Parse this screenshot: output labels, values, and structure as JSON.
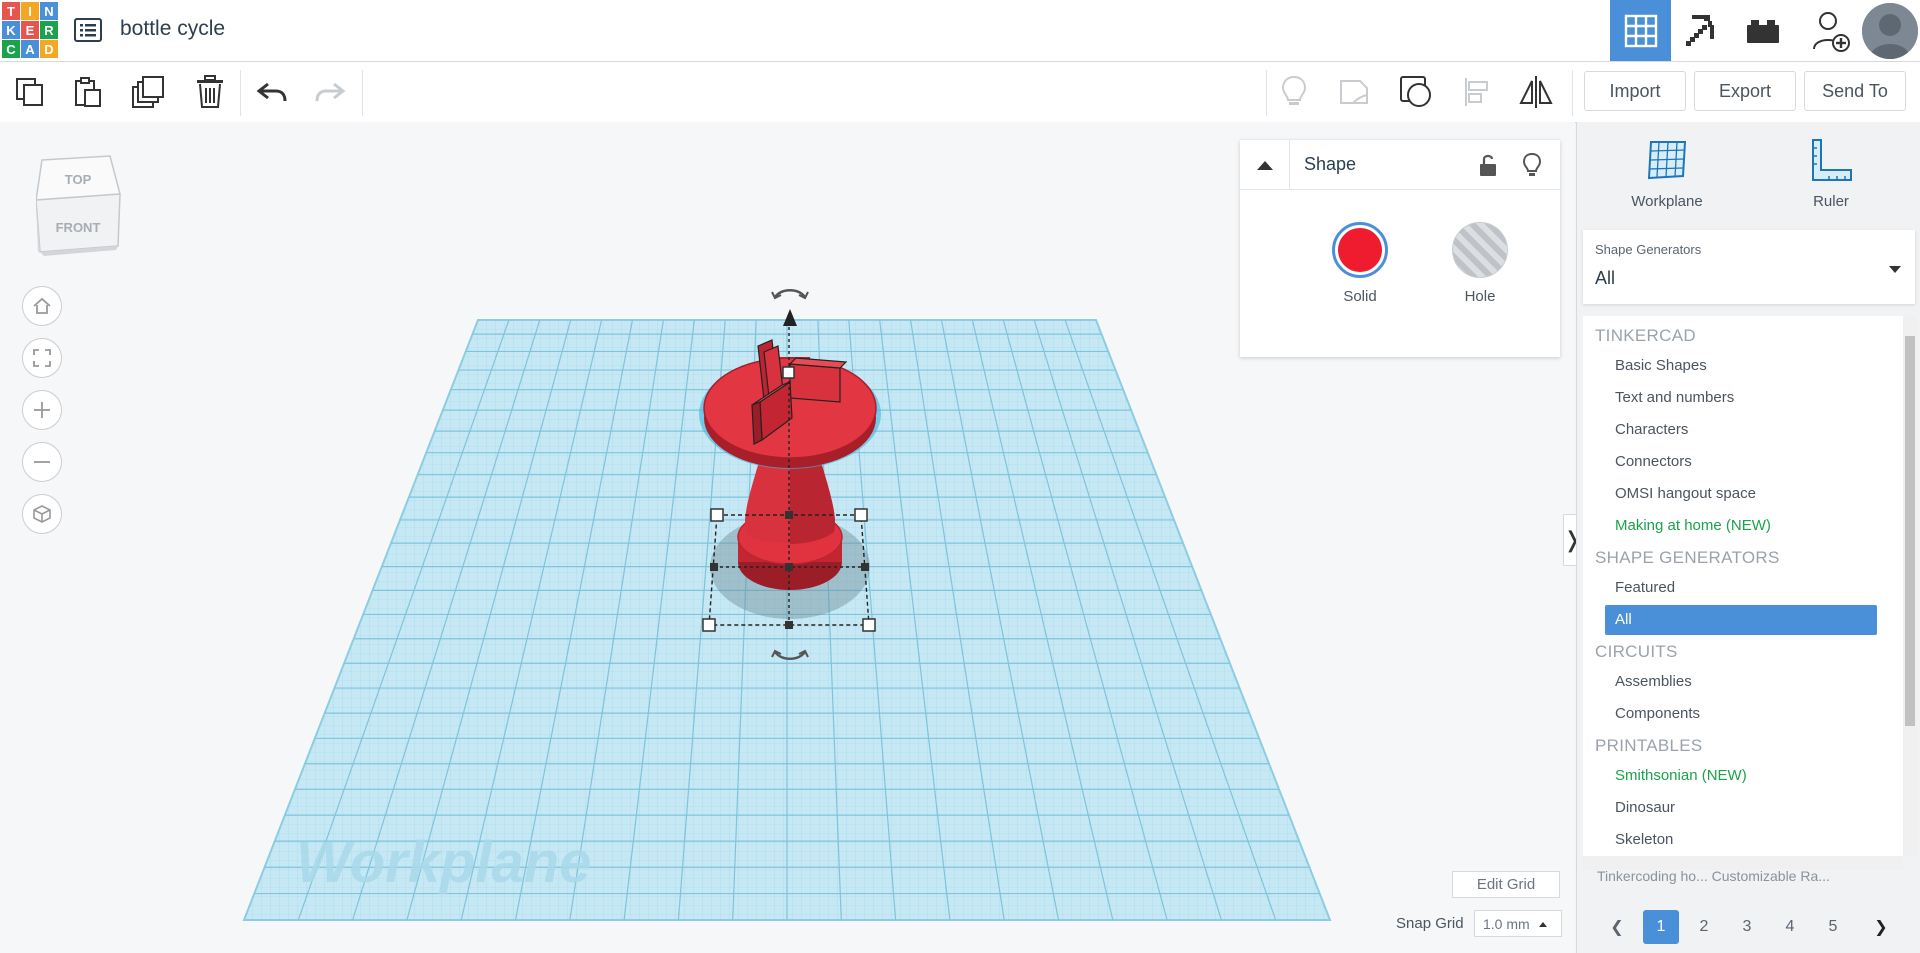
{
  "app": {
    "logo_letters": [
      "T",
      "I",
      "N",
      "K",
      "E",
      "R",
      "C",
      "A",
      "D"
    ],
    "logo_colors": [
      "#e8554e",
      "#f5a623",
      "#4a90d9",
      "#4a90d9",
      "#e8554e",
      "#1aa34a",
      "#1aa34a",
      "#4a90d9",
      "#f5a623"
    ],
    "design_title": "bottle cycle",
    "accent_color": "#4a90d9"
  },
  "header": {
    "buttons": [
      {
        "name": "3d-design-view",
        "icon": "grid-icon",
        "active": true
      },
      {
        "name": "codeblocks",
        "icon": "pickaxe-icon",
        "active": false
      },
      {
        "name": "bricks-view",
        "icon": "brick-icon",
        "active": false
      },
      {
        "name": "add-user",
        "icon": "add-user-icon",
        "active": false
      }
    ]
  },
  "toolbar": {
    "left_icons": [
      "copy-icon",
      "paste-icon",
      "duplicate-icon",
      "delete-icon",
      "undo-icon",
      "redo-icon"
    ],
    "right_icons": [
      "light-bulb-icon",
      "note-icon",
      "show-all-icon",
      "align-icon",
      "mirror-icon"
    ],
    "import_label": "Import",
    "export_label": "Export",
    "send_to_label": "Send To"
  },
  "viewcube": {
    "top_label": "TOP",
    "front_label": "FRONT"
  },
  "viewport": {
    "workplane_watermark": "Workplane",
    "edit_grid_label": "Edit Grid",
    "snap_grid_label": "Snap Grid",
    "snap_grid_value": "1.0 mm"
  },
  "inspector": {
    "title": "Shape",
    "solid_label": "Solid",
    "hole_label": "Hole",
    "solid_color": "#ee1c2e"
  },
  "right_panel": {
    "workplane_label": "Workplane",
    "ruler_label": "Ruler",
    "generators_label": "Shape Generators",
    "generators_value": "All",
    "library": [
      {
        "type": "cat",
        "label": "TINKERCAD"
      },
      {
        "type": "item",
        "label": "Basic Shapes"
      },
      {
        "type": "item",
        "label": "Text and numbers"
      },
      {
        "type": "item",
        "label": "Characters"
      },
      {
        "type": "item",
        "label": "Connectors"
      },
      {
        "type": "item",
        "label": "OMSI hangout space"
      },
      {
        "type": "item",
        "label": "Making at home (NEW)",
        "green": true
      },
      {
        "type": "cat",
        "label": "SHAPE GENERATORS"
      },
      {
        "type": "item",
        "label": "Featured"
      },
      {
        "type": "item",
        "label": "All",
        "selected": true
      },
      {
        "type": "cat",
        "label": "CIRCUITS"
      },
      {
        "type": "item",
        "label": "Assemblies"
      },
      {
        "type": "item",
        "label": "Components"
      },
      {
        "type": "cat",
        "label": "PRINTABLES"
      },
      {
        "type": "item",
        "label": "Smithsonian (NEW)",
        "green": true
      },
      {
        "type": "item",
        "label": "Dinosaur"
      },
      {
        "type": "item",
        "label": "Skeleton"
      }
    ],
    "behind_text": "Tinkercoding ho...   Customizable Ra...",
    "pages": [
      "1",
      "2",
      "3",
      "4",
      "5"
    ],
    "current_page": "1"
  }
}
